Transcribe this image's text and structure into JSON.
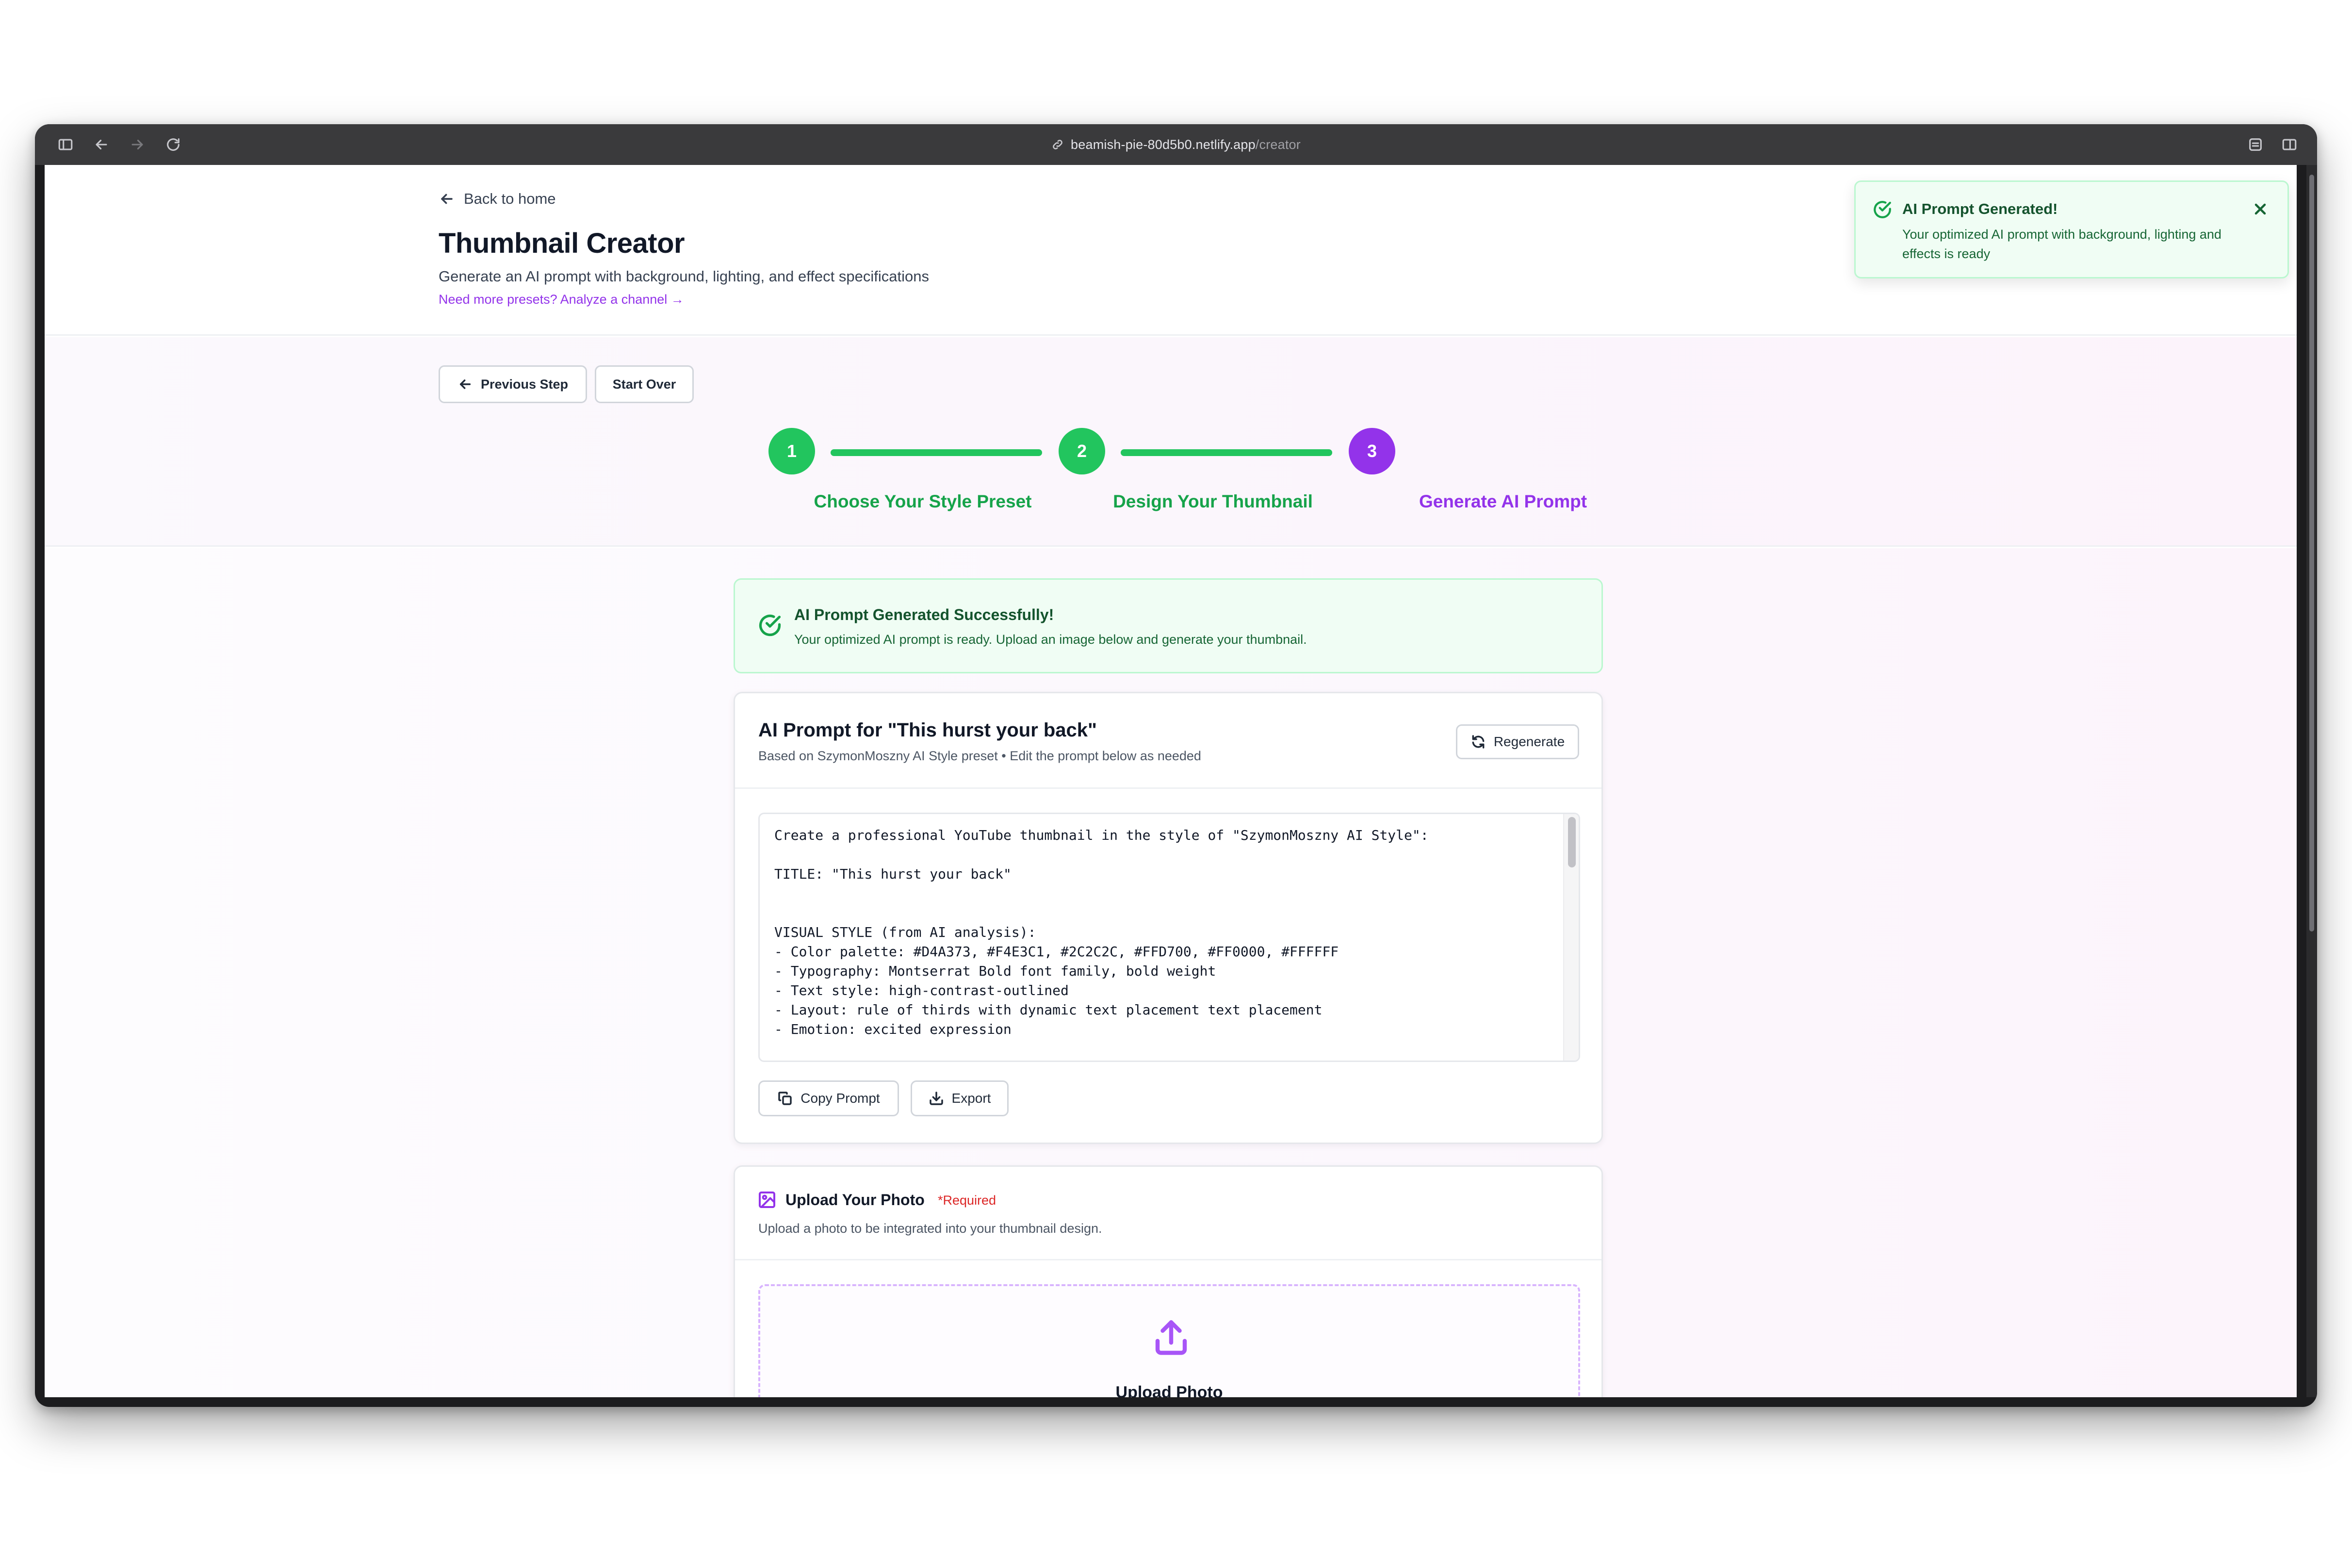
{
  "browser": {
    "url_host": "beamish-pie-80d5b0.netlify.app",
    "url_path": "/creator"
  },
  "header": {
    "back_label": "Back to home",
    "title": "Thumbnail Creator",
    "subtitle": "Generate an AI prompt with background, lighting, and effect specifications",
    "preset_link": "Need more presets? Analyze a channel →"
  },
  "toast": {
    "title": "AI Prompt Generated!",
    "message": "Your optimized AI prompt with background, lighting and effects is ready"
  },
  "nav": {
    "previous_label": "Previous Step",
    "start_over_label": "Start Over"
  },
  "steps": [
    {
      "number": "1",
      "label": "Choose Your Style Preset",
      "status": "complete"
    },
    {
      "number": "2",
      "label": "Design Your Thumbnail",
      "status": "complete"
    },
    {
      "number": "3",
      "label": "Generate AI Prompt",
      "status": "current"
    }
  ],
  "colors": {
    "complete": "#22c55e",
    "complete_text": "#16a34a",
    "current": "#9333ea"
  },
  "success": {
    "title": "AI Prompt Generated Successfully!",
    "message": "Your optimized AI prompt is ready. Upload an image below and generate your thumbnail."
  },
  "prompt_card": {
    "title": "AI Prompt for \"This hurst your back\"",
    "subtitle": "Based on SzymonMoszny AI Style preset • Edit the prompt below as needed",
    "regenerate_label": "Regenerate",
    "prompt_text": "Create a professional YouTube thumbnail in the style of \"SzymonMoszny AI Style\":\n\nTITLE: \"This hurst your back\"\n\n\nVISUAL STYLE (from AI analysis):\n- Color palette: #D4A373, #F4E3C1, #2C2C2C, #FFD700, #FF0000, #FFFFFF\n- Typography: Montserrat Bold font family, bold weight\n- Text style: high-contrast-outlined\n- Layout: rule of thirds with dynamic text placement text placement\n- Emotion: excited expression",
    "copy_label": "Copy Prompt",
    "export_label": "Export"
  },
  "upload_card": {
    "title": "Upload Your Photo",
    "required": "*Required",
    "subtitle": "Upload a photo to be integrated into your thumbnail design.",
    "dropzone_label": "Upload Photo"
  }
}
